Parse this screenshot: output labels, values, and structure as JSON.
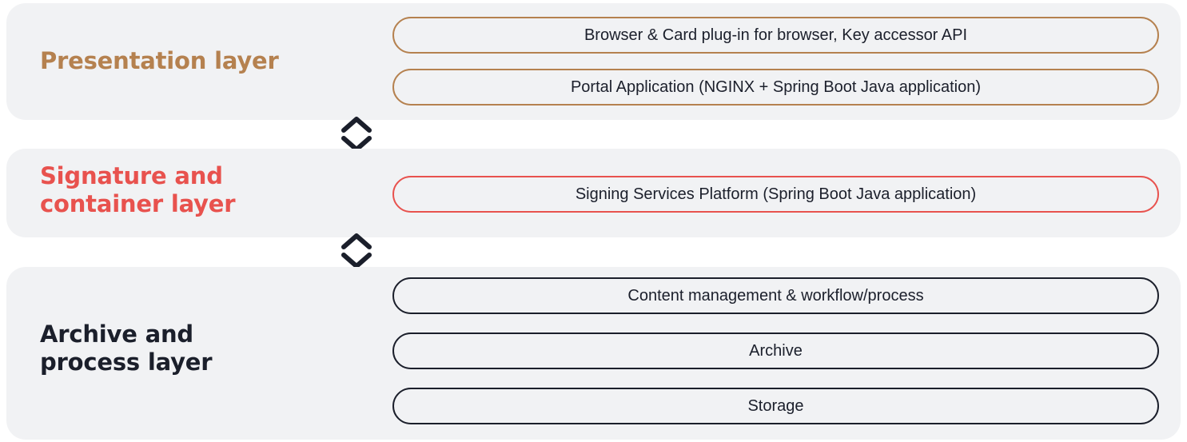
{
  "layers": [
    {
      "title": "Presentation layer",
      "color": "#b5814f",
      "components": [
        "Browser & Card plug-in for browser, Key accessor API",
        "Portal Application (NGINX + Spring Boot Java application)"
      ]
    },
    {
      "title": "Signature and\ncontainer layer",
      "color": "#e8524e",
      "components": [
        "Signing Services Platform (Spring Boot Java application)"
      ]
    },
    {
      "title": "Archive and\nprocess layer",
      "color": "#1b1f2b",
      "components": [
        "Content management & workflow/process",
        "Archive",
        "Storage"
      ]
    }
  ],
  "connectors": [
    {
      "icon": "up-down-chevron-icon",
      "between": [
        "Presentation layer",
        "Signature and container layer"
      ]
    },
    {
      "icon": "up-down-chevron-icon",
      "between": [
        "Signature and container layer",
        "Archive and process layer"
      ]
    }
  ],
  "colors": {
    "panel_background": "#f1f2f4",
    "presentation_accent": "#b5814f",
    "signature_accent": "#e8524e",
    "archive_accent": "#1b1f2b",
    "text": "#1b1f2b"
  }
}
